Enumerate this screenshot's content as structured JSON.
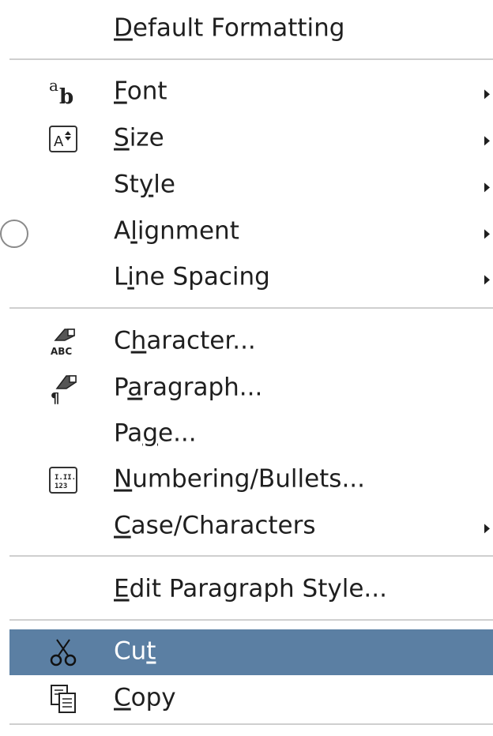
{
  "menu": {
    "items": [
      {
        "id": "default-formatting",
        "pre": "",
        "u": "D",
        "post": "efault Formatting",
        "submenu": false
      },
      {
        "id": "font",
        "pre": "",
        "u": "F",
        "post": "ont",
        "submenu": true,
        "icon": "font-icon"
      },
      {
        "id": "size",
        "pre": "",
        "u": "S",
        "post": "ize",
        "submenu": true,
        "icon": "font-size-icon"
      },
      {
        "id": "style",
        "pre": "St",
        "u": "y",
        "post": "le",
        "submenu": true
      },
      {
        "id": "alignment",
        "pre": "A",
        "u": "l",
        "post": "ignment",
        "submenu": true
      },
      {
        "id": "line-spacing",
        "pre": "L",
        "u": "i",
        "post": "ne Spacing",
        "submenu": true
      },
      {
        "id": "character",
        "pre": "C",
        "u": "h",
        "post": "aracter...",
        "submenu": false,
        "icon": "character-icon"
      },
      {
        "id": "paragraph",
        "pre": "P",
        "u": "a",
        "post": "ragraph...",
        "submenu": false,
        "icon": "paragraph-icon"
      },
      {
        "id": "page",
        "pre": "Pa",
        "u": "g",
        "post": "e...",
        "submenu": false
      },
      {
        "id": "numbering-bullets",
        "pre": "",
        "u": "N",
        "post": "umbering/Bullets...",
        "submenu": false,
        "icon": "numbering-icon"
      },
      {
        "id": "case-characters",
        "pre": "",
        "u": "C",
        "post": "ase/Characters",
        "submenu": true
      },
      {
        "id": "edit-paragraph-style",
        "pre": "",
        "u": "E",
        "post": "dit Paragraph Style...",
        "submenu": false
      },
      {
        "id": "cut",
        "pre": "Cu",
        "u": "t",
        "post": "",
        "submenu": false,
        "icon": "scissors-icon",
        "highlighted": true
      },
      {
        "id": "copy",
        "pre": "",
        "u": "C",
        "post": "opy",
        "submenu": false,
        "icon": "copy-icon"
      }
    ]
  },
  "colors": {
    "highlight": "#5b7fa3",
    "separator": "#cfcfcf",
    "text": "#1f1f1f"
  }
}
